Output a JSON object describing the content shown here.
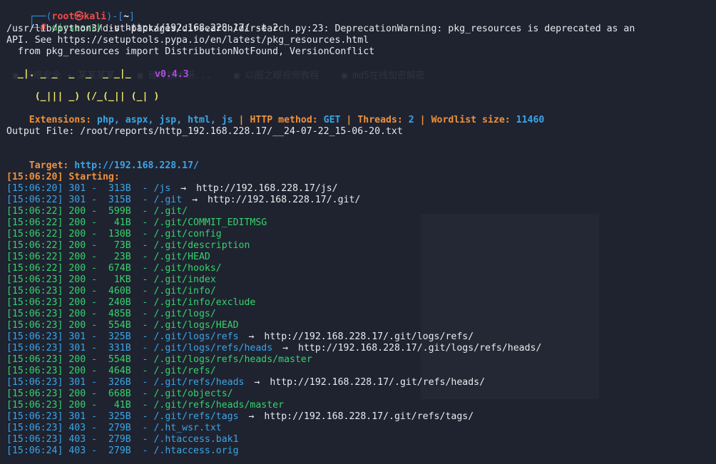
{
  "prompt": {
    "corner1": "┌──(",
    "user": "root",
    "at": "㉿",
    "host": "kali",
    "mid": ")-[",
    "dir": "~",
    "close": "]",
    "corner2": "└─",
    "hash": "#",
    "cmd": "dirsearch",
    "args": " -u http://192.168.228.17/ -t 2"
  },
  "warning": {
    "line1": "/usr/lib/python3/dist-packages/dirsearch/dirsearch.py:23: DeprecationWarning: pkg_resources is deprecated as an",
    "line2": "API. See https://setuptools.pypa.io/en/latest/pkg_resources.html",
    "line3": "  from pkg_resources import DistributionNotFound, VersionConflict"
  },
  "banner": {
    "art1": "  _|. _ _  _  _  _ _|_",
    "art2": " (_||| _) (/_(_|| (_| )",
    "version": "v0.4.3"
  },
  "config": {
    "ext_label": "Extensions: ",
    "ext_value": "php, aspx, jsp, html, js",
    "sep": " | ",
    "method_label": "HTTP method: ",
    "method_value": "GET",
    "threads_label": "Threads: ",
    "threads_value": "2",
    "wordlist_label": "Wordlist size: ",
    "wordlist_value": "11460"
  },
  "output_file": "Output File: /root/reports/http_192.168.228.17/__24-07-22_15-06-20.txt",
  "target": {
    "label": "Target: ",
    "url": "http://192.168.228.17/"
  },
  "starting": "[15:06:20] Starting:",
  "results": [
    {
      "time": "[15:06:20]",
      "code": "301",
      "size": "313B",
      "path": "/js",
      "redirect": "http://192.168.228.17/js/"
    },
    {
      "time": "[15:06:22]",
      "code": "301",
      "size": "315B",
      "path": "/.git",
      "redirect": "http://192.168.228.17/.git/"
    },
    {
      "time": "[15:06:22]",
      "code": "200",
      "size": "599B",
      "path": "/.git/",
      "redirect": ""
    },
    {
      "time": "[15:06:22]",
      "code": "200",
      "size": "41B",
      "path": "/.git/COMMIT_EDITMSG",
      "redirect": ""
    },
    {
      "time": "[15:06:22]",
      "code": "200",
      "size": "130B",
      "path": "/.git/config",
      "redirect": ""
    },
    {
      "time": "[15:06:22]",
      "code": "200",
      "size": "73B",
      "path": "/.git/description",
      "redirect": ""
    },
    {
      "time": "[15:06:22]",
      "code": "200",
      "size": "23B",
      "path": "/.git/HEAD",
      "redirect": ""
    },
    {
      "time": "[15:06:22]",
      "code": "200",
      "size": "674B",
      "path": "/.git/hooks/",
      "redirect": ""
    },
    {
      "time": "[15:06:23]",
      "code": "200",
      "size": "1KB",
      "path": "/.git/index",
      "redirect": ""
    },
    {
      "time": "[15:06:23]",
      "code": "200",
      "size": "460B",
      "path": "/.git/info/",
      "redirect": ""
    },
    {
      "time": "[15:06:23]",
      "code": "200",
      "size": "240B",
      "path": "/.git/info/exclude",
      "redirect": ""
    },
    {
      "time": "[15:06:23]",
      "code": "200",
      "size": "485B",
      "path": "/.git/logs/",
      "redirect": ""
    },
    {
      "time": "[15:06:23]",
      "code": "200",
      "size": "554B",
      "path": "/.git/logs/HEAD",
      "redirect": ""
    },
    {
      "time": "[15:06:23]",
      "code": "301",
      "size": "325B",
      "path": "/.git/logs/refs",
      "redirect": "http://192.168.228.17/.git/logs/refs/"
    },
    {
      "time": "[15:06:23]",
      "code": "301",
      "size": "331B",
      "path": "/.git/logs/refs/heads",
      "redirect": "http://192.168.228.17/.git/logs/refs/heads/"
    },
    {
      "time": "[15:06:23]",
      "code": "200",
      "size": "554B",
      "path": "/.git/logs/refs/heads/master",
      "redirect": ""
    },
    {
      "time": "[15:06:23]",
      "code": "200",
      "size": "464B",
      "path": "/.git/refs/",
      "redirect": ""
    },
    {
      "time": "[15:06:23]",
      "code": "301",
      "size": "326B",
      "path": "/.git/refs/heads",
      "redirect": "http://192.168.228.17/.git/refs/heads/"
    },
    {
      "time": "[15:06:23]",
      "code": "200",
      "size": "668B",
      "path": "/.git/objects/",
      "redirect": ""
    },
    {
      "time": "[15:06:23]",
      "code": "200",
      "size": "41B",
      "path": "/.git/refs/heads/master",
      "redirect": ""
    },
    {
      "time": "[15:06:23]",
      "code": "301",
      "size": "325B",
      "path": "/.git/refs/tags",
      "redirect": "http://192.168.228.17/.git/refs/tags/"
    },
    {
      "time": "[15:06:23]",
      "code": "403",
      "size": "279B",
      "path": "/.ht_wsr.txt",
      "redirect": ""
    },
    {
      "time": "[15:06:23]",
      "code": "403",
      "size": "279B",
      "path": "/.htaccess.bak1",
      "redirect": ""
    },
    {
      "time": "[15:06:24]",
      "code": "403",
      "size": "279B",
      "path": "/.htaccess.orig",
      "redirect": ""
    }
  ],
  "arrow_glyph": "→",
  "colors": {
    "background": "#1f2330",
    "code_200": "#35d36b",
    "code_301": "#3aa5e6",
    "code_403": "#3aa5e6",
    "accent_orange": "#f0913a",
    "accent_blue": "#2f8fdf",
    "accent_purple": "#b04de0"
  }
}
